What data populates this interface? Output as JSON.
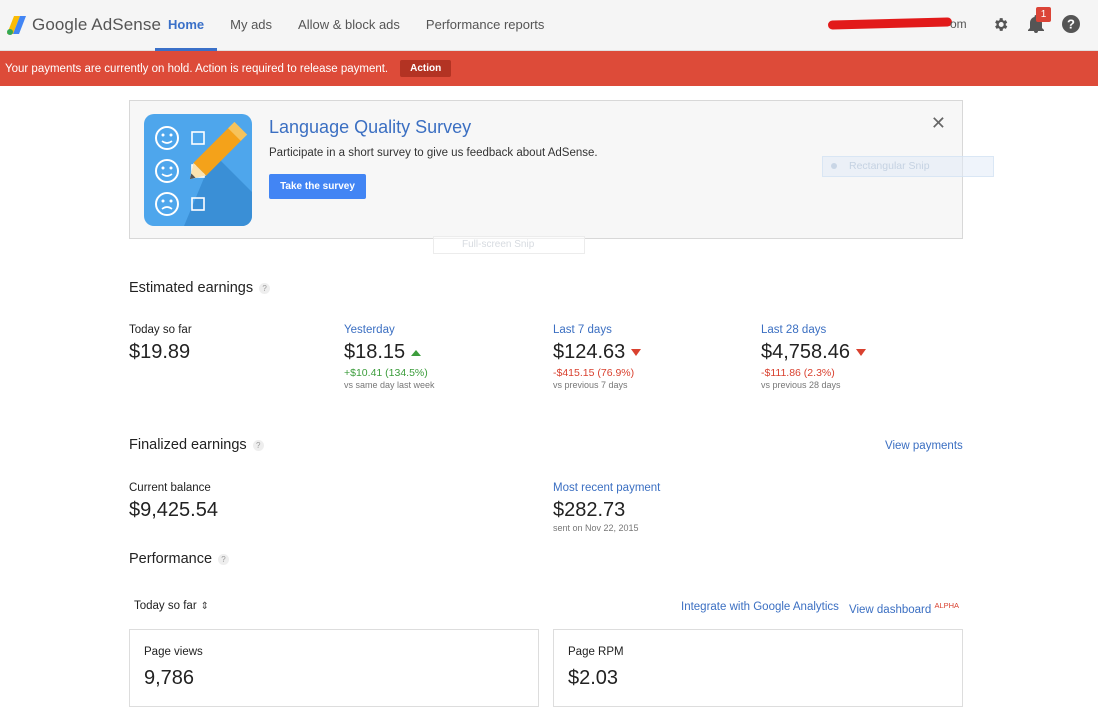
{
  "header": {
    "logo_text": "Google AdSense",
    "nav": [
      {
        "label": "Home",
        "active": true
      },
      {
        "label": "My ads",
        "active": false
      },
      {
        "label": "Allow & block ads",
        "active": false
      },
      {
        "label": "Performance reports",
        "active": false
      }
    ],
    "account_suffix": "om",
    "notification_count": "1",
    "icons": [
      "gear-icon",
      "bell-icon",
      "help-icon"
    ]
  },
  "alert": {
    "message": "Your payments are currently on hold. Action is required to release payment.",
    "action_label": "Action",
    "color": "#dd4b39"
  },
  "survey": {
    "title": "Language Quality Survey",
    "description": "Participate in a short survey to give us feedback about AdSense.",
    "button_label": "Take the survey",
    "close_glyph": "✕"
  },
  "overlays": {
    "rectangular_snip": "Rectangular Snip",
    "fullscreen_snip": "Full-screen Snip"
  },
  "estimated": {
    "title": "Estimated earnings",
    "metrics": [
      {
        "label": "Today so far",
        "value": "$19.89",
        "change": "",
        "sub": "",
        "trend": "none"
      },
      {
        "label": "Yesterday",
        "value": "$18.15",
        "change": "+$10.41 (134.5%)",
        "sub": "vs same day last week",
        "trend": "up"
      },
      {
        "label": "Last 7 days",
        "value": "$124.63",
        "change": "-$415.15 (76.9%)",
        "sub": "vs previous 7 days",
        "trend": "down"
      },
      {
        "label": "Last 28 days",
        "value": "$4,758.46",
        "change": "-$111.86 (2.3%)",
        "sub": "vs previous 28 days",
        "trend": "down"
      }
    ]
  },
  "finalized": {
    "title": "Finalized earnings",
    "view_payments": "View payments",
    "current_balance_label": "Current balance",
    "current_balance_value": "$9,425.54",
    "recent_payment_label": "Most recent payment",
    "recent_payment_value": "$282.73",
    "recent_payment_sub": "sent on Nov 22, 2015"
  },
  "performance": {
    "title": "Performance",
    "range": "Today so far",
    "integrate_link": "Integrate with Google Analytics",
    "dashboard_link": "View dashboard",
    "alpha_badge": "ALPHA",
    "cards": [
      {
        "label": "Page views",
        "value": "9,786"
      },
      {
        "label": "Page RPM",
        "value": "$2.03"
      }
    ]
  }
}
